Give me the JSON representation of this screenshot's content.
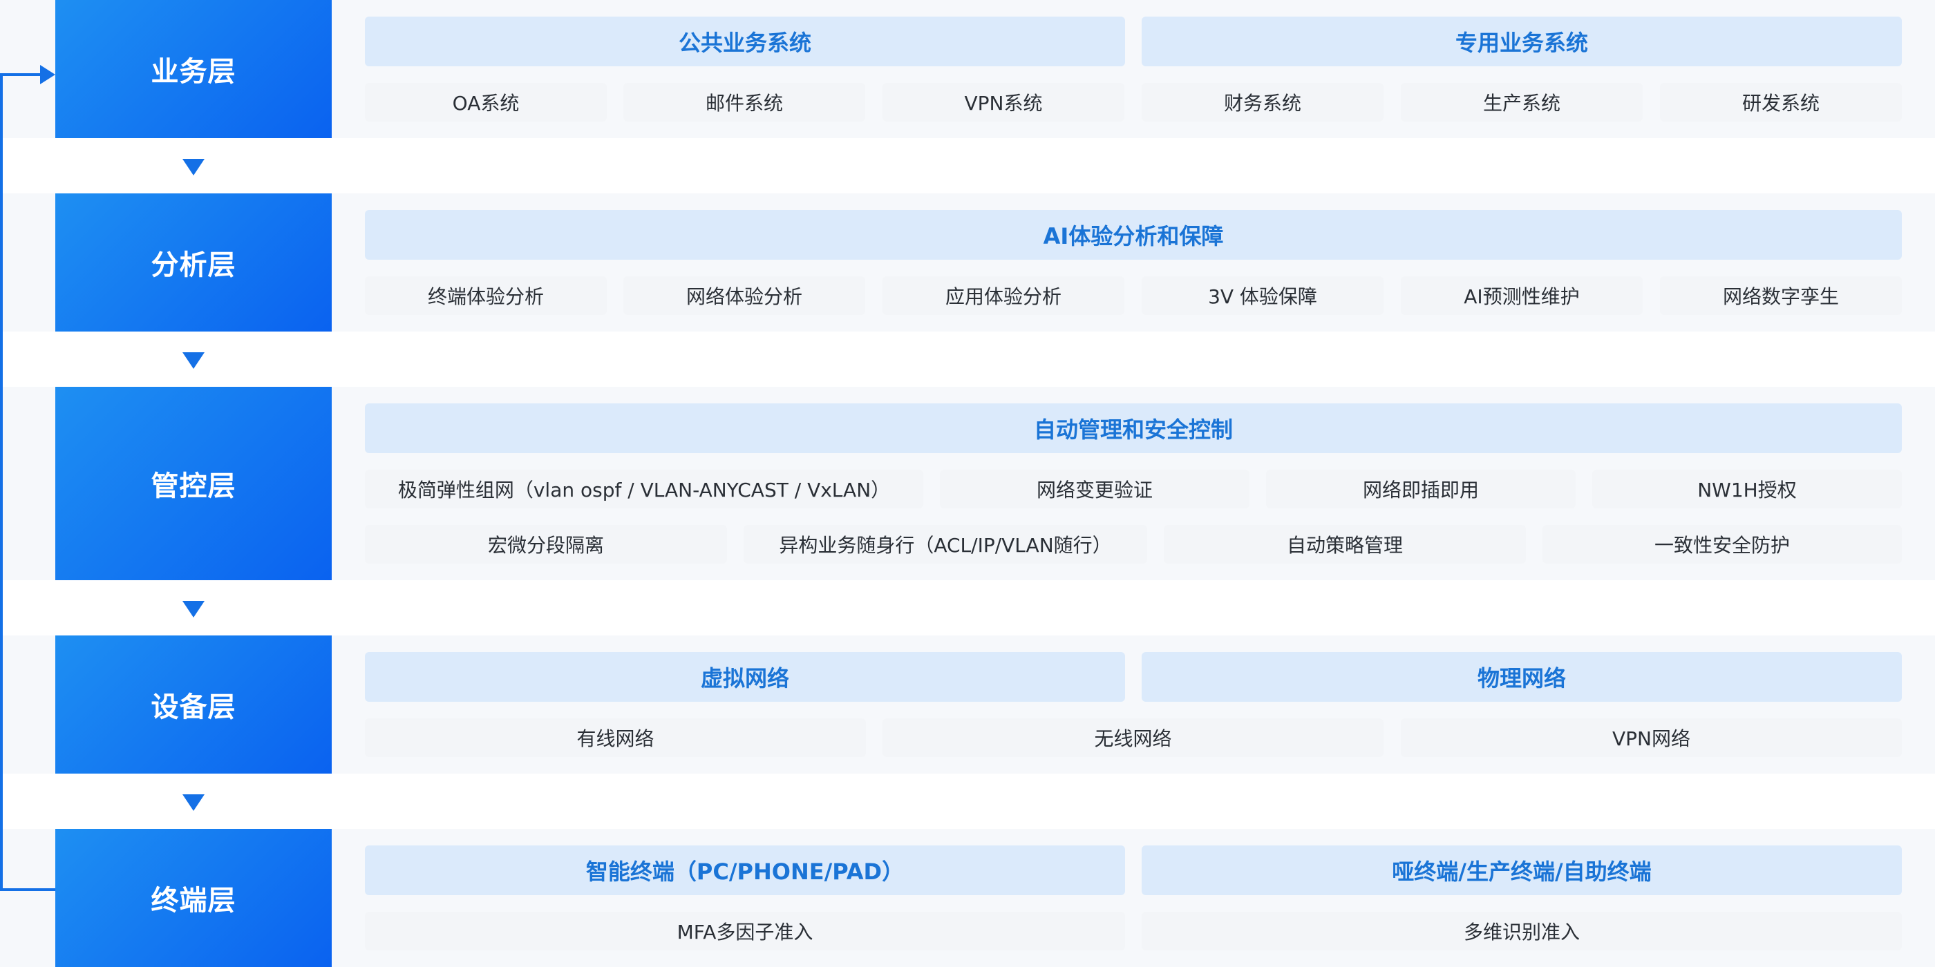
{
  "layers": [
    {
      "label": "业务层",
      "headers": [
        "公共业务系统",
        "专用业务系统"
      ],
      "rows": [
        [
          "OA系统",
          "邮件系统",
          "VPN系统",
          "财务系统",
          "生产系统",
          "研发系统"
        ]
      ]
    },
    {
      "label": "分析层",
      "headers": [
        "AI体验分析和保障"
      ],
      "rows": [
        [
          "终端体验分析",
          "网络体验分析",
          "应用体验分析",
          "3V 体验保障",
          "AI预测性维护",
          "网络数字孪生"
        ]
      ]
    },
    {
      "label": "管控层",
      "headers": [
        "自动管理和安全控制"
      ],
      "rows": [
        [
          "极简弹性组网（vlan ospf / VLAN-ANYCAST / VxLAN）",
          "网络变更验证",
          "网络即插即用",
          "NW1H授权"
        ],
        [
          "宏微分段隔离",
          "异构业务随身行（ACL/IP/VLAN随行）",
          "自动策略管理",
          "一致性安全防护"
        ]
      ]
    },
    {
      "label": "设备层",
      "headers": [
        "虚拟网络",
        "物理网络"
      ],
      "rows": [
        [
          "有线网络",
          "无线网络",
          "VPN网络"
        ]
      ]
    },
    {
      "label": "终端层",
      "headers": [
        "智能终端（PC/PHONE/PAD）",
        "哑终端/生产终端/自助终端"
      ],
      "rows": [
        [
          "MFA多因子准入",
          "多维识别准入"
        ]
      ]
    }
  ],
  "colors": {
    "label_gradient_start": "#1e8ff2",
    "label_gradient_end": "#0a62f0",
    "header_bg": "#dbeafb",
    "header_text": "#1a74d6",
    "item_bg": "#f3f5f8",
    "arrow": "#1470e6"
  }
}
